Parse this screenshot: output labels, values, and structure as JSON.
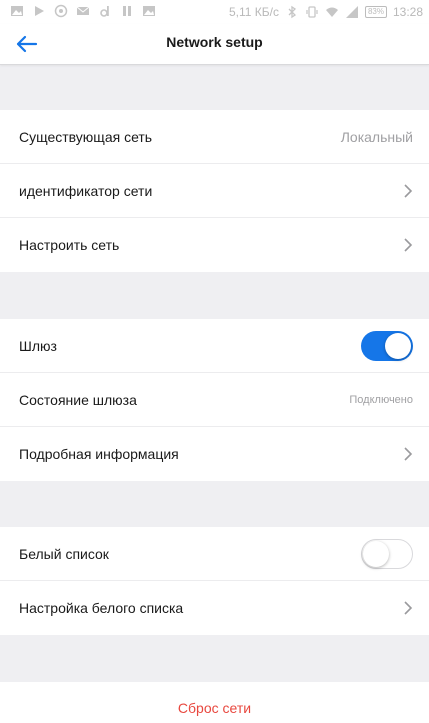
{
  "status_bar": {
    "speed": "5,11 КБ/с",
    "battery": "83%",
    "time": "13:28",
    "icons_left": [
      "image-icon",
      "play-icon",
      "whatsapp-icon",
      "mail-icon",
      "d-app-icon",
      "pause-icon",
      "image-icon"
    ],
    "icons_right": [
      "bluetooth-icon",
      "vibrate-icon",
      "wifi-icon",
      "signal-icon"
    ]
  },
  "header": {
    "title": "Network setup",
    "back_icon": "back-arrow-icon"
  },
  "groups": [
    {
      "rows": [
        {
          "label": "Существующая сеть",
          "value": "Локальный",
          "type": "value"
        },
        {
          "label": "идентификатор сети",
          "type": "chevron"
        },
        {
          "label": "Настроить сеть",
          "type": "chevron"
        }
      ]
    },
    {
      "rows": [
        {
          "label": "Шлюз",
          "type": "toggle",
          "state": "on"
        },
        {
          "label": "Состояние шлюза",
          "value": "Подключено",
          "type": "value"
        },
        {
          "label": "Подробная информация",
          "type": "chevron"
        }
      ]
    },
    {
      "rows": [
        {
          "label": "Белый список",
          "type": "toggle",
          "state": "off"
        },
        {
          "label": "Настройка белого списка",
          "type": "chevron"
        }
      ]
    }
  ],
  "reset": {
    "label": "Сброс сети"
  },
  "colors": {
    "accent": "#1576e8",
    "danger": "#e8483f",
    "background": "#efeff2"
  }
}
